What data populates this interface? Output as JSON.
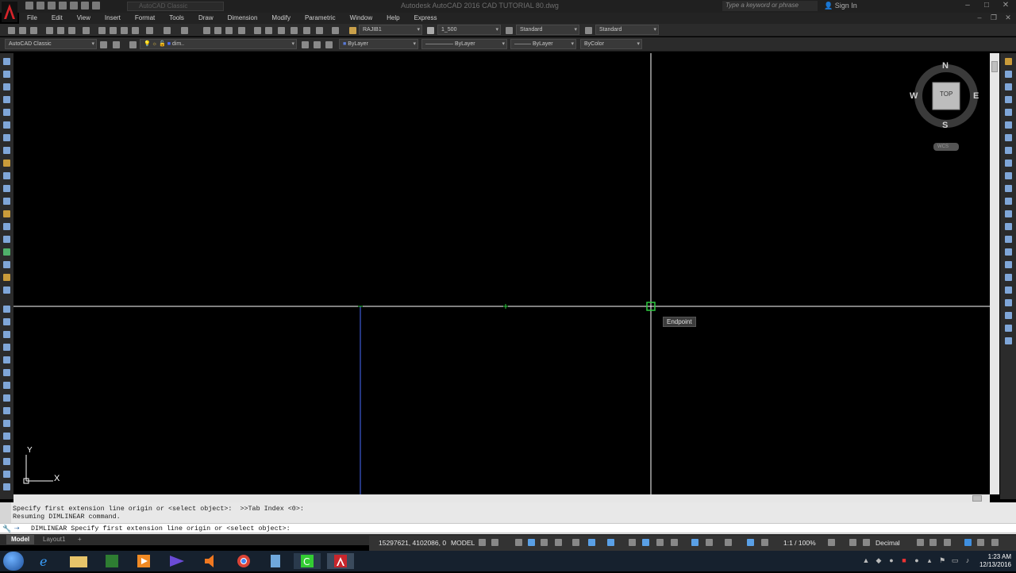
{
  "window": {
    "title": "Autodesk AutoCAD 2016    CAD TUTORIAL 80.dwg",
    "workspace_combo": "AutoCAD Classic",
    "search_placeholder": "Type a keyword or phrase",
    "signin_label": "Sign In"
  },
  "menu": {
    "items": [
      "File",
      "Edit",
      "View",
      "Insert",
      "Format",
      "Tools",
      "Draw",
      "Dimension",
      "Modify",
      "Parametric",
      "Window",
      "Help",
      "Express"
    ]
  },
  "toolbar": {
    "text_style": "RAJIB1",
    "dim_style": "1_500",
    "table_style": "Standard",
    "mleader_style": "Standard",
    "workspace": "AutoCAD Classic",
    "layer": "dim..",
    "color": "ByLayer",
    "linetype": "ByLayer",
    "lineweight": "ByLayer",
    "plot_style": "ByColor"
  },
  "viewcube": {
    "north": "N",
    "south": "S",
    "east": "E",
    "west": "W",
    "face": "TOP",
    "wcs": "WCS"
  },
  "canvas": {
    "tooltip": "Endpoint",
    "ucs_x": "X",
    "ucs_y": "Y"
  },
  "command": {
    "history_line1": "Specify first extension line origin or <select object>:  >>Tab Index <0>:",
    "history_line2": "Resuming DIMLINEAR command.",
    "current": "DIMLINEAR Specify first extension line origin or <select object>:"
  },
  "tabs": {
    "model": "Model",
    "layout1": "Layout1",
    "add": "+"
  },
  "status": {
    "coordinates": "15297621, 4102086, 0",
    "space": "MODEL",
    "annotation_scale": "1:1 / 100%",
    "units": "Decimal"
  },
  "taskbar": {
    "time": "1:23 AM",
    "date": "12/13/2016"
  },
  "colors": {
    "canvas_bg": "#000000",
    "crosshair": "#ffffff",
    "osnap_marker": "#2ecc40",
    "dimension_line": "#4a6cff"
  }
}
